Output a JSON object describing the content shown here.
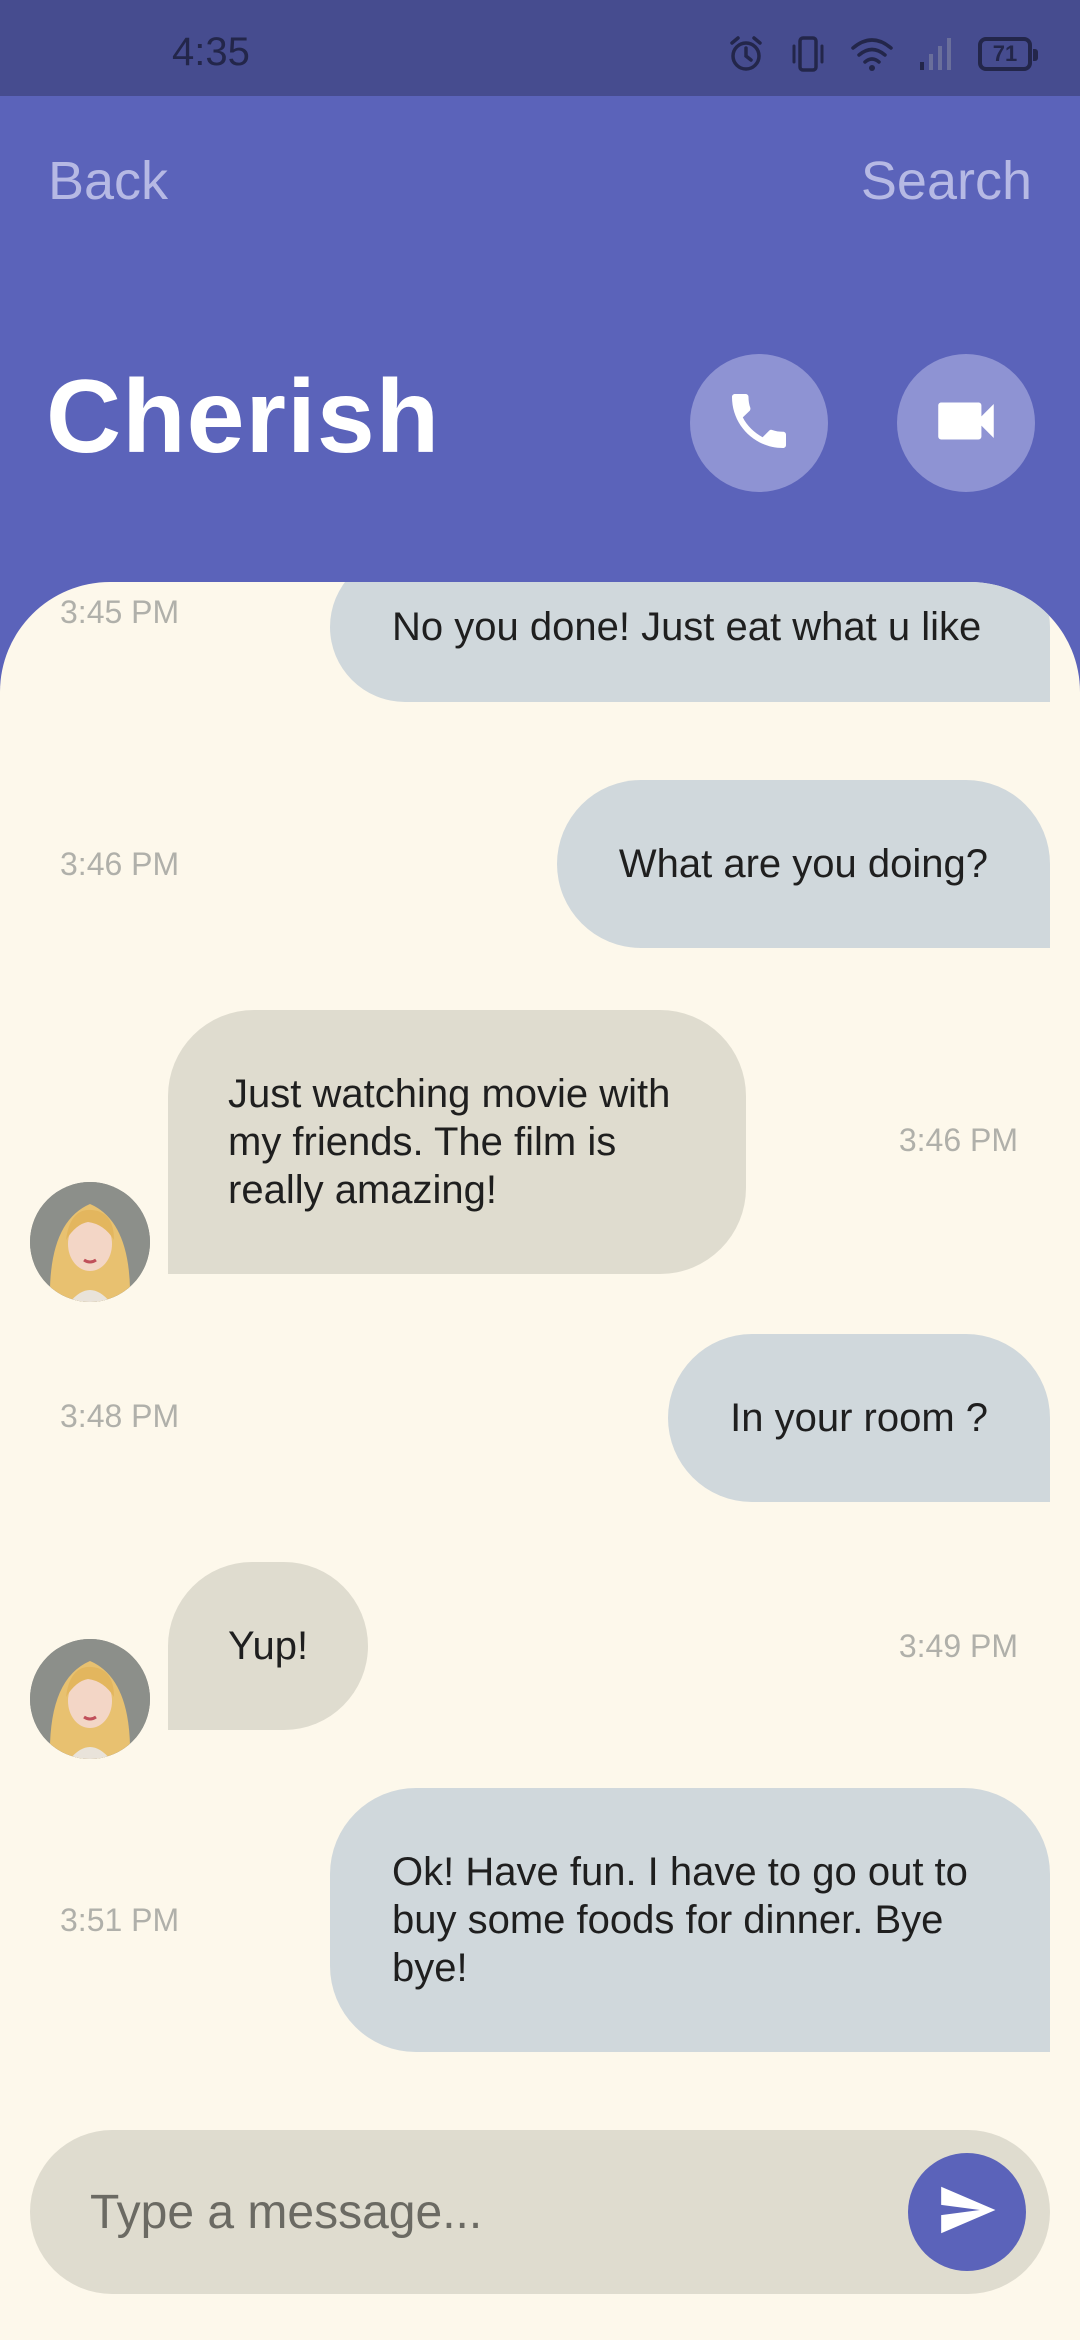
{
  "status_bar": {
    "time": "4:35",
    "battery": "71",
    "icons": [
      "alarm-icon",
      "vibrate-icon",
      "wifi-icon",
      "signal-icon",
      "battery-icon"
    ]
  },
  "header": {
    "back_label": "Back",
    "search_label": "Search",
    "contact_name": "Cherish",
    "call_icon": "phone-icon",
    "video_icon": "video-camera-icon"
  },
  "messages": [
    {
      "from": "me",
      "text": "No you done! Just eat what u like",
      "time": "3:45 PM"
    },
    {
      "from": "me",
      "text": "What are you doing?",
      "time": "3:46 PM"
    },
    {
      "from": "them",
      "text": "Just watching movie with my friends. The film is really amazing!",
      "time": "3:46 PM"
    },
    {
      "from": "me",
      "text": "In your room ?",
      "time": "3:48 PM"
    },
    {
      "from": "them",
      "text": "Yup!",
      "time": "3:49 PM"
    },
    {
      "from": "me",
      "text": "Ok! Have fun. I have to go out to buy some foods for dinner. Bye bye!",
      "time": "3:51 PM"
    }
  ],
  "composer": {
    "placeholder": "Type a message...",
    "value": "",
    "send_icon": "send-icon"
  },
  "colors": {
    "accent": "#5b63ba",
    "status_bar": "#464c8f",
    "chat_background": "#fdf8eb",
    "my_bubble": "#d0d8dc",
    "their_bubble": "#dfdccf"
  }
}
